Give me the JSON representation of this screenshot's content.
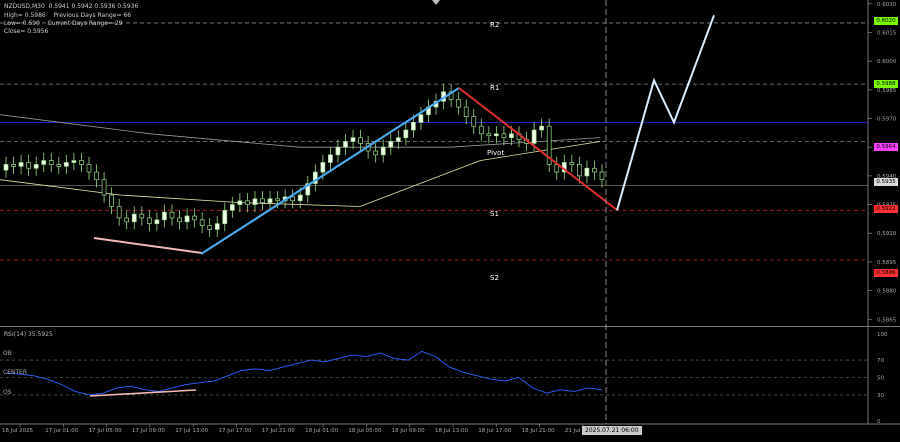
{
  "header": {
    "symbol_line": "NZDUSD,M30  0.5941 0.5942 0.5936 0.5936",
    "line2": "High= 0.5986    Previous Days Range= 66",
    "line3": "Low= 0.590    Current Days Range= 29",
    "line4": "Close= 0.5956"
  },
  "levels": {
    "r2": "R2",
    "r1": "R1",
    "pivot": "Pivot",
    "s1": "S1",
    "s2": "S2"
  },
  "price_tags": [
    {
      "text": "0.6020",
      "color": "#7cfc00"
    },
    {
      "text": "0.5988",
      "color": "#7cfc00"
    },
    {
      "text": "0.5964",
      "color": "#ff40ff"
    },
    {
      "text": "0.5935",
      "color": "#d8d8d8"
    },
    {
      "text": "0.5922",
      "color": "#ff3030"
    },
    {
      "text": "0.5896",
      "color": "#ff3030"
    }
  ],
  "rsi": {
    "label": "RSI(14) 35.5925",
    "ob": "OB",
    "center": "CENTER",
    "os": "OS"
  },
  "date_tag": "2025.07.21 06:00",
  "chart_data": {
    "type": "candlestick",
    "symbol": "NZDUSD",
    "timeframe": "M30",
    "price_axis": {
      "ylim": [
        0.5862,
        0.6032
      ],
      "ticks": [
        "0.6030",
        "0.6015",
        "0.6000",
        "0.5985",
        "0.5970",
        "0.5955",
        "0.5940",
        "0.5925",
        "0.5910",
        "0.5895",
        "0.5880",
        "0.5865"
      ]
    },
    "rsi_axis": {
      "ylim": [
        0,
        100
      ],
      "ticks": [
        "100",
        "70",
        "50",
        "30",
        "0"
      ]
    },
    "x_tick_labels": [
      "16 Jul 2025",
      "17 Jul 01:00",
      "17 Jul 05:00",
      "17 Jul 09:00",
      "17 Jul 13:00",
      "17 Jul 17:00",
      "17 Jul 21:00",
      "18 Jul 01:00",
      "18 Jul 05:00",
      "18 Jul 09:00",
      "18 Jul 13:00",
      "18 Jul 17:00",
      "18 Jul 21:00",
      "21 Jul 01:00"
    ],
    "closes": [
      0.5946,
      0.5945,
      0.5947,
      0.5944,
      0.5946,
      0.5948,
      0.5946,
      0.5945,
      0.5947,
      0.5948,
      0.5946,
      0.5942,
      0.5938,
      0.593,
      0.5924,
      0.5918,
      0.5916,
      0.592,
      0.5918,
      0.5915,
      0.5917,
      0.5921,
      0.5918,
      0.5916,
      0.5919,
      0.5917,
      0.5914,
      0.5912,
      0.5915,
      0.5922,
      0.5925,
      0.5927,
      0.5925,
      0.5928,
      0.5926,
      0.5928,
      0.5927,
      0.5929,
      0.5927,
      0.593,
      0.5936,
      0.5942,
      0.5947,
      0.5951,
      0.5955,
      0.5958,
      0.596,
      0.5957,
      0.5953,
      0.5951,
      0.5955,
      0.5958,
      0.596,
      0.5964,
      0.5968,
      0.5972,
      0.5976,
      0.5979,
      0.5984,
      0.598,
      0.5976,
      0.5971,
      0.5966,
      0.5962,
      0.5961,
      0.5962,
      0.596,
      0.5962,
      0.5959,
      0.5957,
      0.5964,
      0.5966,
      0.5946,
      0.5942,
      0.5947,
      0.5946,
      0.594,
      0.5944,
      0.5942,
      0.5938
    ],
    "pivot_levels": {
      "R2": 0.602,
      "R1": 0.5988,
      "Pivot": 0.5958,
      "S1": 0.5922,
      "S2": 0.5896
    },
    "blue_line": 0.5968,
    "gray_line": 0.5935,
    "moving_averages": [
      {
        "color": "#9a9a9a",
        "values": [
          0.5972,
          0.5962,
          0.5955,
          0.5955,
          0.596
        ]
      },
      {
        "color": "#e8e4a8",
        "values": [
          0.5938,
          0.593,
          0.5926,
          0.5924,
          0.5948,
          0.5958
        ]
      }
    ],
    "rsi_values": [
      55,
      54,
      52,
      48,
      42,
      34,
      30,
      32,
      38,
      40,
      36,
      34,
      38,
      42,
      44,
      46,
      52,
      58,
      60,
      58,
      62,
      66,
      70,
      68,
      72,
      76,
      74,
      78,
      72,
      70,
      80,
      74,
      62,
      56,
      52,
      48,
      46,
      50,
      38,
      32,
      36,
      34,
      38,
      36
    ],
    "annotations": {
      "projection": [
        0.5922,
        0.599,
        0.5968,
        0.6024
      ],
      "up_leg": [
        "17 Jul 13:00",
        "18 Jul 13:00"
      ],
      "down_leg": [
        "18 Jul 13:00",
        "21 Jul 06:00"
      ]
    }
  }
}
